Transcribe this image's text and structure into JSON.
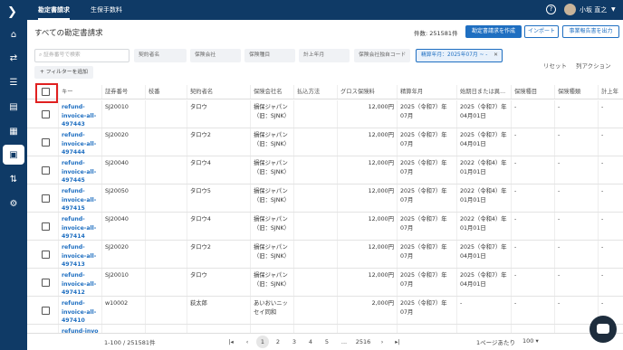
{
  "topbar": {
    "tabs": [
      "勘定書請求",
      "生保手数料"
    ],
    "user_name": "小坂 直之"
  },
  "page": {
    "title": "すべての勘定書請求",
    "count_text": "件数: 251581件"
  },
  "actions": {
    "create": "勘定書請求を作成",
    "import": "インポート",
    "export": "事業報告書を出力"
  },
  "filters": {
    "search_placeholder": "証券番号で検索",
    "items": [
      "契約者名",
      "保険会社",
      "保険種目",
      "計上年月",
      "保険会社独自コード"
    ],
    "active": "精算年月：2025年07月 ~ -",
    "add_label": "フィルターを追加",
    "reset_label": "リセット",
    "columns_label": "列アクション"
  },
  "table": {
    "headers": [
      "キー",
      "証券番号",
      "枝番",
      "契約者名",
      "保険会社名",
      "払込方法",
      "グロス保険料",
      "精算年月",
      "始期日または異...",
      "保険種目",
      "保険種類",
      "計上年"
    ],
    "rows": [
      {
        "key": "refund-invoice-all-497443",
        "policy": "SJ20010",
        "branch": "",
        "holder": "タロウ",
        "insurer": "損保ジャパン（旧：SJNK）",
        "method": "",
        "premium": "12,000円",
        "settle": "2025（令和7）年07月",
        "start": "2025（令和7）年04月01日",
        "kind": "-",
        "type": "-",
        "acct": "-"
      },
      {
        "key": "refund-invoice-all-497444",
        "policy": "SJ20020",
        "branch": "",
        "holder": "タロウ2",
        "insurer": "損保ジャパン（旧：SJNK）",
        "method": "",
        "premium": "12,000円",
        "settle": "2025（令和7）年07月",
        "start": "2025（令和7）年04月01日",
        "kind": "-",
        "type": "-",
        "acct": "-"
      },
      {
        "key": "refund-invoice-all-497445",
        "policy": "SJ20040",
        "branch": "",
        "holder": "タロウ4",
        "insurer": "損保ジャパン（旧：SJNK）",
        "method": "",
        "premium": "12,000円",
        "settle": "2025（令和7）年07月",
        "start": "2022（令和4）年01月01日",
        "kind": "-",
        "type": "-",
        "acct": "-"
      },
      {
        "key": "refund-invoice-all-497415",
        "policy": "SJ20050",
        "branch": "",
        "holder": "タロウ5",
        "insurer": "損保ジャパン（旧：SJNK）",
        "method": "",
        "premium": "12,000円",
        "settle": "2025（令和7）年07月",
        "start": "2022（令和4）年01月01日",
        "kind": "-",
        "type": "-",
        "acct": "-"
      },
      {
        "key": "refund-invoice-all-497414",
        "policy": "SJ20040",
        "branch": "",
        "holder": "タロウ4",
        "insurer": "損保ジャパン（旧：SJNK）",
        "method": "",
        "premium": "12,000円",
        "settle": "2025（令和7）年07月",
        "start": "2022（令和4）年01月01日",
        "kind": "-",
        "type": "-",
        "acct": "-"
      },
      {
        "key": "refund-invoice-all-497413",
        "policy": "SJ20020",
        "branch": "",
        "holder": "タロウ2",
        "insurer": "損保ジャパン（旧：SJNK）",
        "method": "",
        "premium": "12,000円",
        "settle": "2025（令和7）年07月",
        "start": "2025（令和7）年04月01日",
        "kind": "-",
        "type": "-",
        "acct": "-"
      },
      {
        "key": "refund-invoice-all-497412",
        "policy": "SJ20010",
        "branch": "",
        "holder": "タロウ",
        "insurer": "損保ジャパン（旧：SJNK）",
        "method": "",
        "premium": "12,000円",
        "settle": "2025（令和7）年07月",
        "start": "2025（令和7）年04月01日",
        "kind": "-",
        "type": "-",
        "acct": "-"
      },
      {
        "key": "refund-invoice-all-497410",
        "policy": "w10002",
        "branch": "",
        "holder": "荻太郎",
        "insurer": "あいおいニッセイ同和",
        "method": "",
        "premium": "2,000円",
        "settle": "2025（令和7）年07月",
        "start": "-",
        "kind": "-",
        "type": "-",
        "acct": "-"
      },
      {
        "key": "refund-invo",
        "policy": "",
        "branch": "",
        "holder": "",
        "insurer": "",
        "method": "",
        "premium": "",
        "settle": "",
        "start": "",
        "kind": "",
        "type": "",
        "acct": ""
      }
    ]
  },
  "pagination": {
    "range": "1-100 / 251581件",
    "pages": [
      "1",
      "2",
      "3",
      "4",
      "5",
      "...",
      "2516"
    ],
    "per_page_label": "1ページあたり",
    "per_page_value": "100"
  }
}
